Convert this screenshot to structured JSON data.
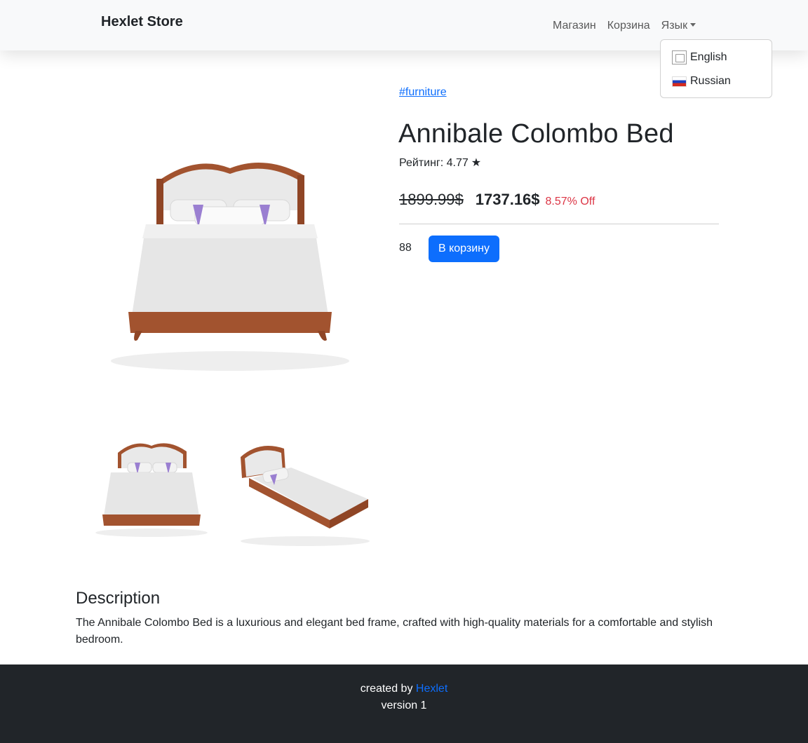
{
  "navbar": {
    "brand": "Hexlet Store",
    "links": {
      "shop": "Магазин",
      "cart": "Корзина",
      "language": "Язык"
    }
  },
  "language_menu": {
    "items": [
      {
        "label": "English",
        "icon": "broken-image-flag-icon"
      },
      {
        "label": "Russian",
        "icon": "russian-flag-icon"
      }
    ]
  },
  "product": {
    "tag": "#furniture",
    "title": "Annibale Colombo Bed",
    "rating_label": "Рейтинг: 4.77",
    "rating_star": "★",
    "old_price": "1899.99$",
    "new_price": "1737.16$",
    "discount": "8.57% Off",
    "stock": "88",
    "add_to_cart": "В корзину",
    "images": [
      "bed-front-image",
      "bed-front-thumbnail",
      "bed-angle-thumbnail"
    ]
  },
  "description": {
    "heading": "Description",
    "text": "The Annibale Colombo Bed is a luxurious and elegant bed frame, crafted with high-quality materials for a comfortable and stylish bedroom."
  },
  "footer": {
    "created_by": "created by",
    "author": "Hexlet",
    "version": "version 1"
  },
  "colors": {
    "primary": "#0d6efd",
    "discount": "#dc3545",
    "footer_bg": "#212529",
    "navbar_bg": "#f8f9fa"
  }
}
